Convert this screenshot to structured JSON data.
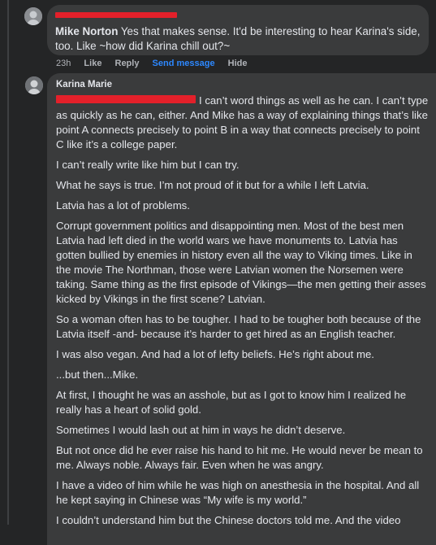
{
  "comment1": {
    "author": "Mike Norton",
    "text": "Yes that makes sense. It'd be interesting to hear Karina's side, too. Like ~how did Karina chill out?~",
    "actions": {
      "time": "23h",
      "like": "Like",
      "reply": "Reply",
      "send_message": "Send message",
      "hide": "Hide"
    }
  },
  "comment2": {
    "author": "Karina Marie",
    "paragraphs": [
      "I can’t word things as well as he can. I can’t type as quickly as he can, either. And Mike has a way of explaining things that’s like point A connects precisely to point B in a way that connects precisely to point C like it’s a college paper.",
      "I can’t really write like him but I can try.",
      "What he says is true. I’m not proud of it but for a while I left Latvia.",
      "Latvia has a lot of problems.",
      "Corrupt government politics and disappointing men. Most of the best men Latvia had left died in the world wars we have monuments to. Latvia has gotten bullied by enemies in history even all the way to Viking times. Like in the movie The Northman, those were Latvian women the Norsemen were taking. Same thing as the first episode of Vikings—the men getting their asses kicked by Vikings in the first scene? Latvian.",
      "So a woman often has to be tougher. I had to be tougher both because of the Latvia itself -and- because it’s harder to get hired as an English teacher.",
      "I was also vegan. And had a lot of lefty beliefs. He’s right about me.",
      "...but then...Mike.",
      "At first, I thought he was an asshole, but as I got to know him I realized he really has a heart of solid gold.",
      "Sometimes I would lash out at him in ways he didn’t deserve.",
      "But not once did he ever raise his hand to hit me. He would never be mean to me. Always noble. Always fair. Even when he was angry.",
      "I have a video of him while he was high on anesthesia in the hospital. And all he kept saying in Chinese was “My wife is my world.”",
      "I couldn’t understand him but the Chinese doctors told me. And the video"
    ]
  }
}
